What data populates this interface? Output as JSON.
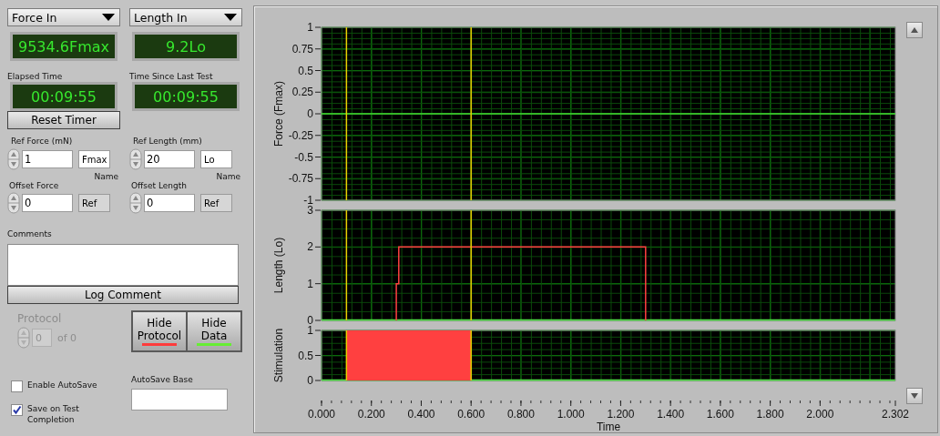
{
  "selectors": [
    {
      "label": "Force In"
    },
    {
      "label": "Length In"
    }
  ],
  "readouts": [
    {
      "value": "9534.6Fmax"
    },
    {
      "value": "9.2Lo"
    }
  ],
  "timers": [
    {
      "label": "Elapsed Time",
      "value": "00:09:55"
    },
    {
      "label": "Time Since Last Test",
      "value": "00:09:55"
    }
  ],
  "reset_button": "Reset Timer",
  "references": [
    {
      "label": "Ref Force (mN)",
      "value": "1",
      "unit": "Fmax",
      "name_label": "Name",
      "offset_label": "Offset Force",
      "offset_value": "0",
      "offset_unit": "Ref"
    },
    {
      "label": "Ref Length (mm)",
      "value": "20",
      "unit": "Lo",
      "name_label": "Name",
      "offset_label": "Offset Length",
      "offset_value": "0",
      "offset_unit": "Ref"
    }
  ],
  "comments": {
    "label": "Comments"
  },
  "log_button": "Log Comment",
  "protocol": {
    "label": "Protocol",
    "value": "0",
    "of": "of 0",
    "disabled": true
  },
  "toggle_buttons": [
    {
      "line1": "Hide",
      "line2": "Protocol",
      "color": "#ff3b3b"
    },
    {
      "line1": "Hide",
      "line2": "Data",
      "color": "#66ee33"
    }
  ],
  "autosave_base": {
    "label": "AutoSave Base"
  },
  "checkboxes": [
    {
      "label": "Enable AutoSave",
      "checked": false
    },
    {
      "label": "Save on Test Completion",
      "checked": true
    }
  ],
  "charts": [
    {
      "chart_data": {
        "type": "line",
        "ylabel": "Force (Fmax)",
        "xlim": [
          0,
          2.302
        ],
        "ylim": [
          -1,
          1
        ],
        "yticks": [
          1,
          0.75,
          0.5,
          0.25,
          0,
          -0.25,
          -0.5,
          -0.75,
          -1
        ],
        "x": [
          0,
          2.302
        ],
        "series": [
          {
            "color": "#44dd33",
            "values": [
              0,
              0
            ]
          }
        ],
        "grid": true,
        "ref_lines": [
          {
            "axis": "x",
            "value": 0.1,
            "color": "#e8d000"
          },
          {
            "axis": "x",
            "value": 0.6,
            "color": "#e8d000"
          }
        ]
      }
    },
    {
      "chart_data": {
        "type": "line",
        "ylabel": "Length (Lo)",
        "xlim": [
          0,
          2.302
        ],
        "ylim": [
          0,
          3
        ],
        "yticks": [
          0,
          1,
          2,
          3
        ],
        "x": [
          0.3,
          0.3,
          0.31,
          0.31,
          1.3,
          1.3
        ],
        "series": [
          {
            "color": "#ff4040",
            "values": [
              0,
              1,
              1,
              2,
              2,
              0
            ]
          }
        ],
        "grid": true,
        "ref_lines": [
          {
            "axis": "x",
            "value": 0.1,
            "color": "#e8d000"
          },
          {
            "axis": "x",
            "value": 0.6,
            "color": "#e8d000"
          }
        ]
      }
    },
    {
      "chart_data": {
        "type": "area",
        "ylabel": "Stimulation",
        "xlabel": "Time",
        "xlim": [
          0,
          2.302
        ],
        "ylim": [
          0,
          1
        ],
        "yticks": [
          0,
          0.5,
          1
        ],
        "xticks": [
          {
            "value": 0,
            "label": "0.000"
          },
          {
            "value": 0.2,
            "label": "0.200"
          },
          {
            "value": 0.4,
            "label": "0.400"
          },
          {
            "value": 0.6,
            "label": "0.600"
          },
          {
            "value": 0.8,
            "label": "0.800"
          },
          {
            "value": 1,
            "label": "1.000"
          },
          {
            "value": 1.2,
            "label": "1.200"
          },
          {
            "value": 1.4,
            "label": "1.400"
          },
          {
            "value": 1.6,
            "label": "1.600"
          },
          {
            "value": 1.8,
            "label": "1.800"
          },
          {
            "value": 2,
            "label": "2.000"
          },
          {
            "value": 2.302,
            "label": "2.302"
          }
        ],
        "x": [
          0.1,
          0.1,
          0.6,
          0.6
        ],
        "series": [
          {
            "color": "#ff4040",
            "values": [
              0,
              1,
              1,
              0
            ]
          }
        ],
        "grid": true,
        "ref_lines": [
          {
            "axis": "x",
            "value": 0.1,
            "color": "#e8d000"
          },
          {
            "axis": "x",
            "value": 0.6,
            "color": "#e8d000"
          }
        ]
      }
    }
  ]
}
